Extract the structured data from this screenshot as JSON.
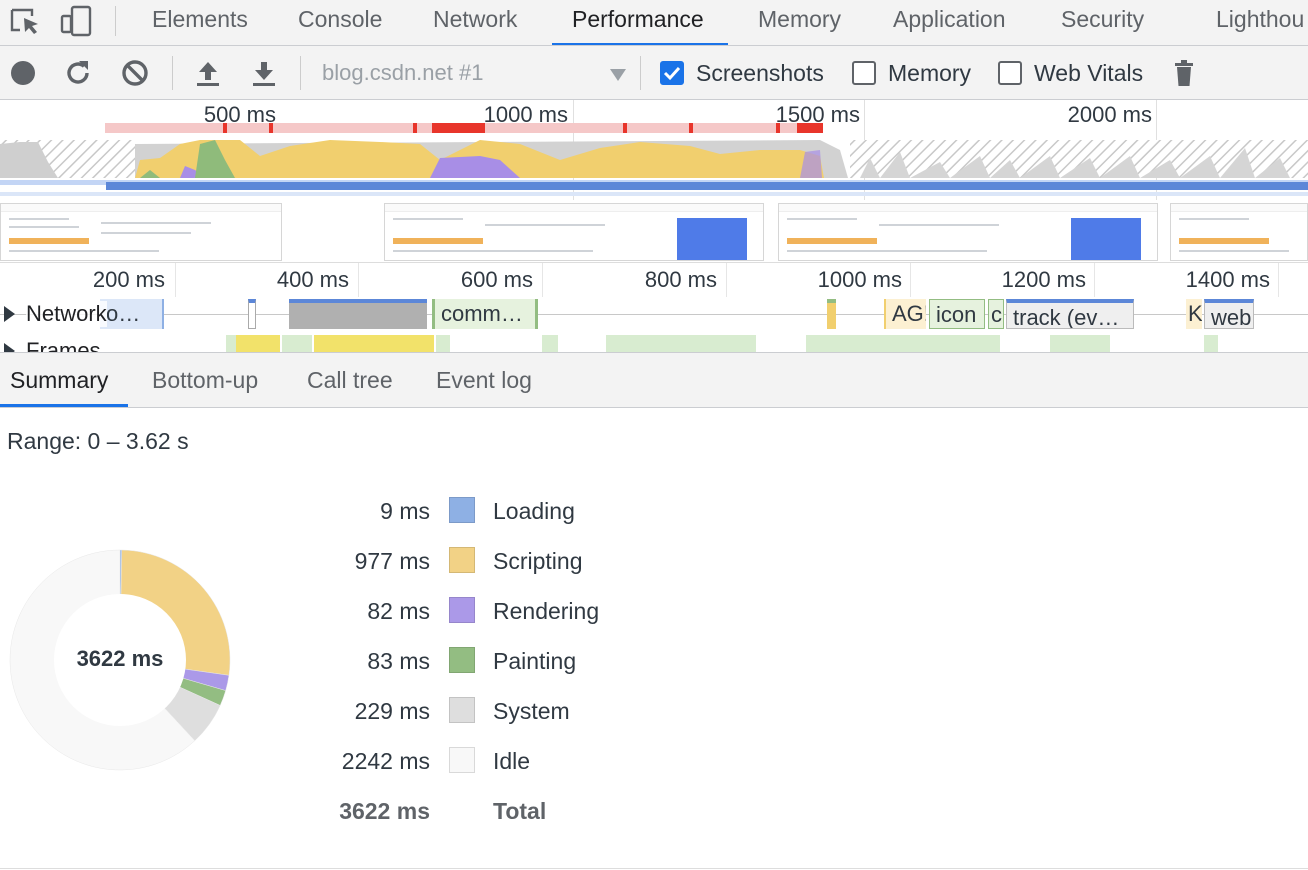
{
  "tabs": [
    {
      "label": "Elements"
    },
    {
      "label": "Console"
    },
    {
      "label": "Network"
    },
    {
      "label": "Performance"
    },
    {
      "label": "Memory"
    },
    {
      "label": "Application"
    },
    {
      "label": "Security"
    },
    {
      "label": "Lighthou"
    }
  ],
  "active_tab": "Performance",
  "toolbar": {
    "profile": "blog.csdn.net #1",
    "screenshots_label": "Screenshots",
    "screenshots_checked": true,
    "memory_label": "Memory",
    "memory_checked": false,
    "webvitals_label": "Web Vitals",
    "webvitals_checked": false
  },
  "overview": {
    "ticks": [
      "500 ms",
      "1000 ms",
      "1500 ms",
      "2000 ms"
    ]
  },
  "ruler": {
    "ticks": [
      "200 ms",
      "400 ms",
      "600 ms",
      "800 ms",
      "1000 ms",
      "1200 ms",
      "1400 ms"
    ]
  },
  "tracks": {
    "network": {
      "title": "Network",
      "bars": [
        {
          "label": "o…"
        },
        {
          "label": ""
        },
        {
          "label": ""
        },
        {
          "label": "comm…"
        },
        {
          "label": ""
        },
        {
          "label": "AG!"
        },
        {
          "label": "icon"
        },
        {
          "label": "c"
        },
        {
          "label": "track (ev…"
        },
        {
          "label": "K"
        },
        {
          "label": "web"
        }
      ]
    },
    "frames": {
      "title": "Frames"
    }
  },
  "bottom_tabs": [
    {
      "label": "Summary"
    },
    {
      "label": "Bottom-up"
    },
    {
      "label": "Call tree"
    },
    {
      "label": "Event log"
    }
  ],
  "summary": {
    "range": "Range: 0 – 3.62 s",
    "total_center": "3622 ms",
    "rows": [
      {
        "value": "9 ms",
        "name": "Loading",
        "color": "#8eb0e4"
      },
      {
        "value": "977 ms",
        "name": "Scripting",
        "color": "#f2d286"
      },
      {
        "value": "82 ms",
        "name": "Rendering",
        "color": "#ab99e8"
      },
      {
        "value": "83 ms",
        "name": "Painting",
        "color": "#93bd82"
      },
      {
        "value": "229 ms",
        "name": "System",
        "color": "#dedede"
      },
      {
        "value": "2242 ms",
        "name": "Idle",
        "color": "#f8f8f8"
      }
    ],
    "total": {
      "value": "3622 ms",
      "name": "Total"
    }
  }
}
